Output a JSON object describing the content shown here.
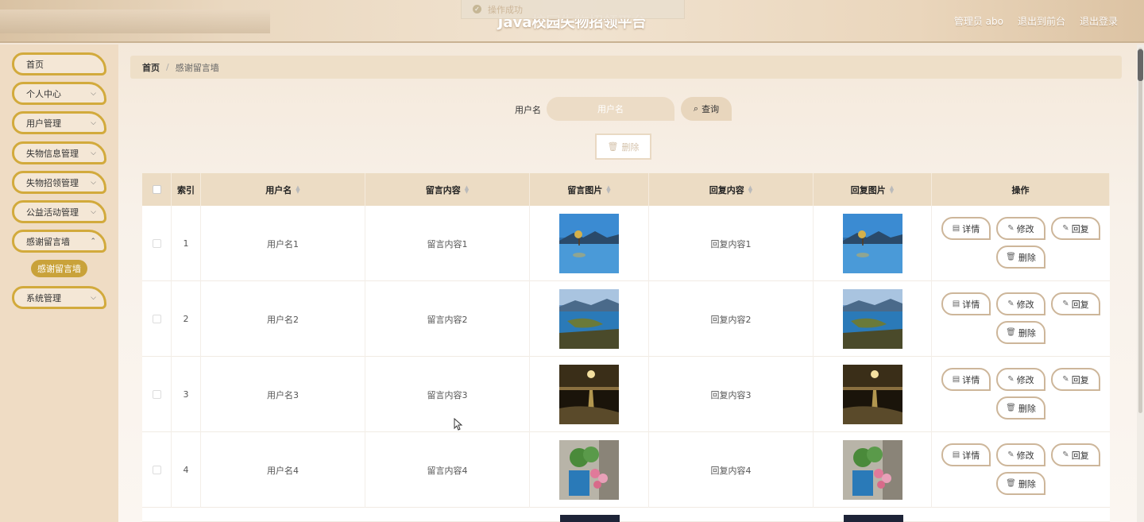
{
  "header": {
    "title": "Java校园失物招领平台",
    "user": "管理员 abo",
    "to_front": "退出到前台",
    "logout": "退出登录"
  },
  "toast": {
    "text": "操作成功"
  },
  "sidebar": {
    "items": [
      {
        "label": "首页",
        "chevron": false
      },
      {
        "label": "个人中心",
        "chevron": true
      },
      {
        "label": "用户管理",
        "chevron": true
      },
      {
        "label": "失物信息管理",
        "chevron": true
      },
      {
        "label": "失物招领管理",
        "chevron": true
      },
      {
        "label": "公益活动管理",
        "chevron": true
      },
      {
        "label": "感谢留言墙",
        "chevron": true
      },
      {
        "label": "系统管理",
        "chevron": true
      }
    ],
    "active_sub": "感谢留言墙"
  },
  "breadcrumb": {
    "home": "首页",
    "sep": "/",
    "current": "感谢留言墙"
  },
  "search": {
    "label": "用户名",
    "placeholder": "用户名",
    "button": "查询"
  },
  "toolbar": {
    "delete": "删除"
  },
  "table": {
    "columns": [
      "索引",
      "用户名",
      "留言内容",
      "留言图片",
      "回复内容",
      "回复图片",
      "操作"
    ],
    "actions": {
      "detail": "详情",
      "edit": "修改",
      "reply": "回复",
      "delete": "删除"
    },
    "rows": [
      {
        "index": "1",
        "username": "用户名1",
        "message": "留言内容1",
        "reply": "回复内容1",
        "image": "lake-tree"
      },
      {
        "index": "2",
        "username": "用户名2",
        "message": "留言内容2",
        "reply": "回复内容2",
        "image": "lake-peninsula"
      },
      {
        "index": "3",
        "username": "用户名3",
        "message": "留言内容3",
        "reply": "回复内容3",
        "image": "sunset-beach"
      },
      {
        "index": "4",
        "username": "用户名4",
        "message": "留言内容4",
        "reply": "回复内容4",
        "image": "flower-pot"
      }
    ]
  },
  "colors": {
    "accent": "#d2aa3c",
    "header_bg": "#ecdcc4",
    "sidebar_bg": "#efdcc4"
  }
}
